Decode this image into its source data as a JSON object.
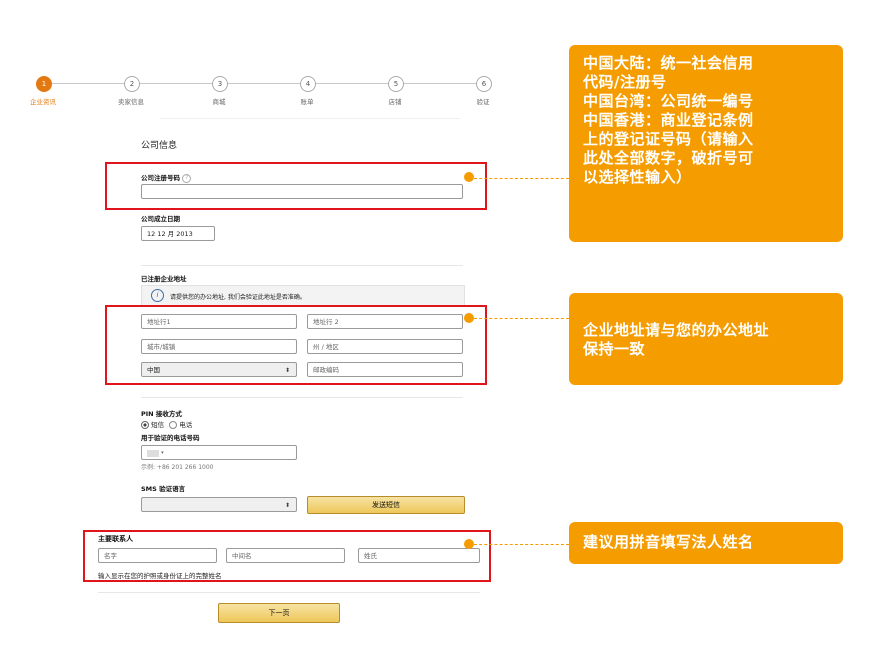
{
  "stepper": {
    "steps": [
      {
        "number": "1",
        "label": "企业资讯"
      },
      {
        "number": "2",
        "label": "卖家信息"
      },
      {
        "number": "3",
        "label": "商城"
      },
      {
        "number": "4",
        "label": "账单"
      },
      {
        "number": "5",
        "label": "店铺"
      },
      {
        "number": "6",
        "label": "验证"
      }
    ]
  },
  "company": {
    "section_title": "公司信息",
    "reg_number_label": "公司注册号码",
    "reg_number_value": "",
    "founded_label": "公司成立日期",
    "founded_value": "12 12 月 2013"
  },
  "address": {
    "section_label": "已注册企业地址",
    "info_text": "请提供您的办公地址, 我们会验证此地址是否准确。",
    "line1_placeholder": "地址行1",
    "line2_placeholder": "地址行 2",
    "city_placeholder": "城市/城镇",
    "state_placeholder": "州 / 地区",
    "country_value": "中国",
    "postal_placeholder": "邮政编码"
  },
  "pin": {
    "method_label": "PIN 接收方式",
    "option_sms": "短信",
    "option_phone": "电话",
    "phone_label": "用于验证的电话号码",
    "phone_example": "示例: +86 201 266 1000",
    "sms_lang_label": "SMS 验证语言",
    "send_button": "发送短信"
  },
  "contact": {
    "section_label": "主要联系人",
    "first_placeholder": "名字",
    "middle_placeholder": "中间名",
    "last_placeholder": "姓氏",
    "hint": "输入显示在您的护照或身份证上的完整姓名"
  },
  "next_button": "下一页",
  "callouts": {
    "reg_lines": [
      "中国大陆：统一社会信用",
      "代码/注册号",
      "中国台湾：公司统一编号",
      "中国香港：商业登记条例",
      "上的登记证号码（请输入",
      "此处全部数字，破折号可",
      "以选择性输入）"
    ],
    "address_lines": [
      "企业地址请与您的办公地址",
      "保持一致"
    ],
    "name_lines": [
      "建议用拼音填写法人姓名"
    ]
  },
  "colors": {
    "accent": "#f59c00",
    "highlight_border": "#e0151b",
    "step_active": "#e47911"
  }
}
